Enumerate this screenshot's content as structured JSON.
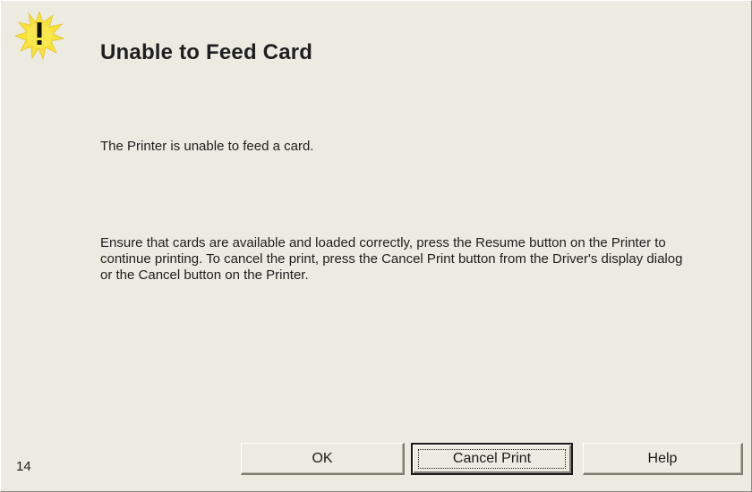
{
  "dialog": {
    "title": "Unable to Feed Card",
    "message_primary": "The Printer is unable to feed a card.",
    "message_detail": "Ensure that cards are available and loaded correctly, press the Resume button on the Printer to continue printing. To cancel the print, press the Cancel Print button from the Driver's display dialog or the Cancel button on the Printer.",
    "error_code": "14",
    "icon": "warning-exclamation-icon",
    "buttons": {
      "ok_label": "OK",
      "cancel_print_label": "Cancel Print",
      "help_label": "Help"
    }
  },
  "colors": {
    "background": "#ecebe1",
    "icon_yellow": "#f6e23a"
  }
}
